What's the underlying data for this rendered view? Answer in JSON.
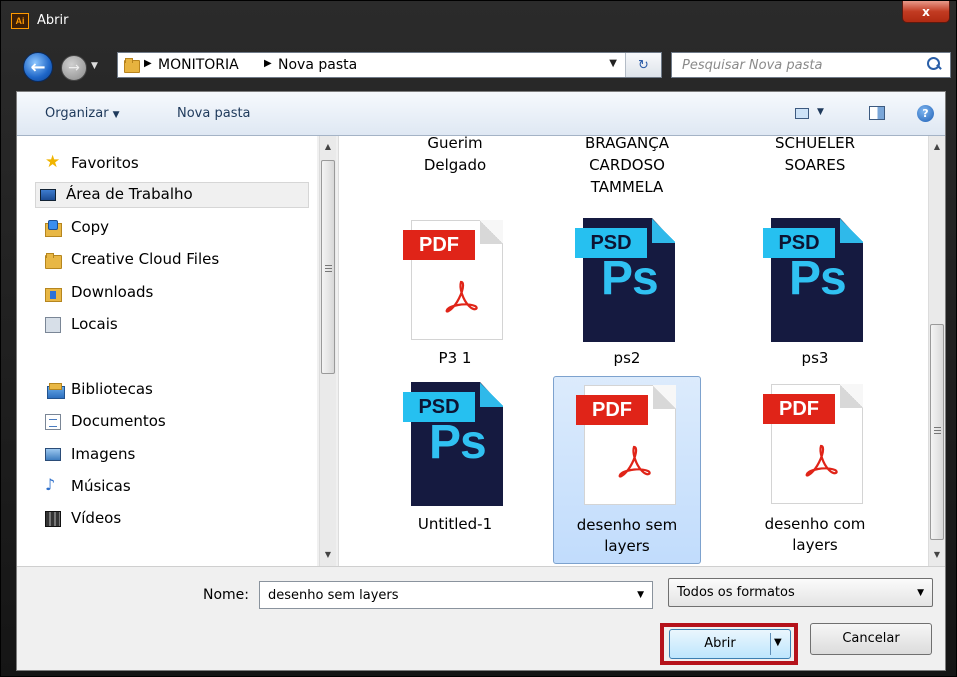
{
  "window": {
    "title": "Abrir",
    "app_icon_text": "Ai",
    "close_label": "x"
  },
  "navigation": {
    "breadcrumbs": [
      "MONITORIA",
      "Nova pasta"
    ],
    "search_placeholder": "Pesquisar Nova pasta"
  },
  "toolbar": {
    "organize_label": "Organizar",
    "new_folder_label": "Nova pasta"
  },
  "sidebar": {
    "favorites": {
      "label": "Favoritos",
      "items": [
        {
          "label": "Área de Trabalho",
          "icon": "desktop-icon",
          "selected": true
        },
        {
          "label": "Copy",
          "icon": "copy-folder-icon"
        },
        {
          "label": "Creative Cloud Files",
          "icon": "folder-icon"
        },
        {
          "label": "Downloads",
          "icon": "downloads-icon"
        },
        {
          "label": "Locais",
          "icon": "recent-places-icon"
        }
      ]
    },
    "libraries": {
      "label": "Bibliotecas",
      "items": [
        {
          "label": "Documentos",
          "icon": "documents-icon"
        },
        {
          "label": "Imagens",
          "icon": "pictures-icon"
        },
        {
          "label": "Músicas",
          "icon": "music-icon"
        },
        {
          "label": "Vídeos",
          "icon": "videos-icon"
        }
      ]
    }
  },
  "files": {
    "partial_row": [
      {
        "name_lines": [
          "Guerim",
          "Delgado"
        ]
      },
      {
        "name_lines": [
          "BRAGANÇA",
          "CARDOSO",
          "TAMMELA"
        ]
      },
      {
        "name_lines": [
          "SCHUELER",
          "SOARES"
        ]
      }
    ],
    "items": [
      {
        "name": "P3 1",
        "type": "PDF",
        "selected": false
      },
      {
        "name": "ps2",
        "type": "PSD",
        "selected": false
      },
      {
        "name": "ps3",
        "type": "PSD",
        "selected": false
      },
      {
        "name": "Untitled-1",
        "type": "PSD",
        "selected": false
      },
      {
        "name_lines": [
          "desenho sem",
          "layers"
        ],
        "type": "PDF",
        "selected": true
      },
      {
        "name_lines": [
          "desenho com",
          "layers"
        ],
        "type": "PDF",
        "selected": false
      }
    ],
    "ps_glyph": "Ps"
  },
  "bottom": {
    "name_label": "Nome:",
    "name_value": "desenho sem layers",
    "format_value": "Todos os formatos",
    "open_label": "Abrir",
    "cancel_label": "Cancelar"
  },
  "colors": {
    "pdf_red": "#e02418",
    "psd_blue": "#26c0f0",
    "psd_dark": "#151a40",
    "highlight_red": "#b5121b",
    "selection_blue": "#c1dcfc"
  }
}
